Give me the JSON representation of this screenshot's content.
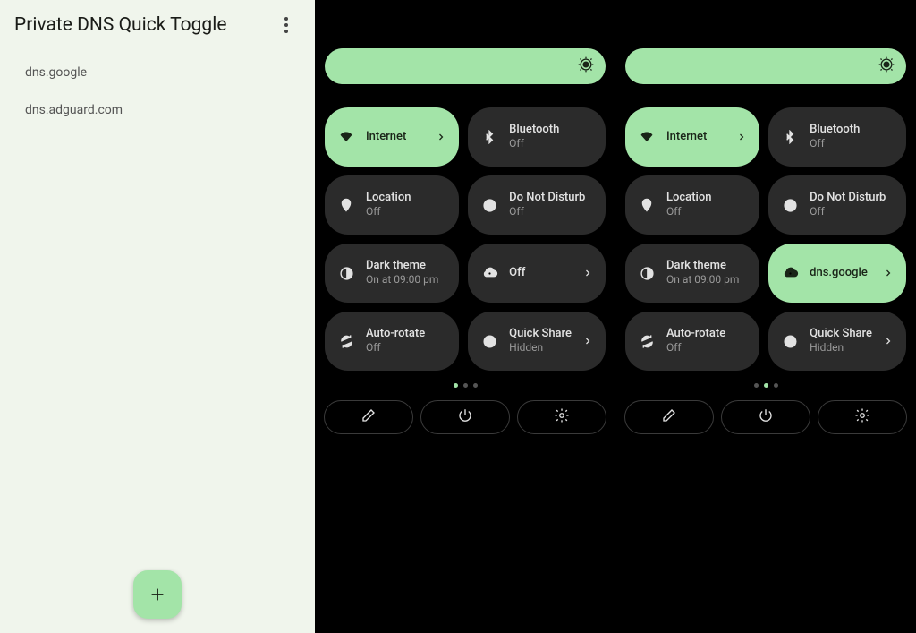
{
  "app": {
    "title": "Private DNS Quick Toggle",
    "dns_entries": [
      "dns.google",
      "dns.adguard.com"
    ]
  },
  "colors": {
    "accent": "#a3e4a8",
    "tile_bg": "#2b2b2b"
  },
  "panels": [
    {
      "tiles": [
        {
          "icon": "wifi",
          "title": "Internet",
          "sub": "",
          "active": true,
          "chevron": true
        },
        {
          "icon": "bt",
          "title": "Bluetooth",
          "sub": "Off",
          "active": false,
          "chevron": false
        },
        {
          "icon": "location",
          "title": "Location",
          "sub": "Off",
          "active": false,
          "chevron": false
        },
        {
          "icon": "dnd",
          "title": "Do Not Disturb",
          "sub": "Off",
          "active": false,
          "chevron": false
        },
        {
          "icon": "dark",
          "title": "Dark theme",
          "sub": "On at 09:00 pm",
          "active": false,
          "chevron": false
        },
        {
          "icon": "cloud",
          "title": "Off",
          "sub": "",
          "active": false,
          "chevron": true
        },
        {
          "icon": "rotate",
          "title": "Auto-rotate",
          "sub": "Off",
          "active": false,
          "chevron": false
        },
        {
          "icon": "share",
          "title": "Quick Share",
          "sub": "Hidden",
          "active": false,
          "chevron": true
        }
      ],
      "active_dot": 0
    },
    {
      "tiles": [
        {
          "icon": "wifi",
          "title": "Internet",
          "sub": "",
          "active": true,
          "chevron": true
        },
        {
          "icon": "bt",
          "title": "Bluetooth",
          "sub": "Off",
          "active": false,
          "chevron": false
        },
        {
          "icon": "location",
          "title": "Location",
          "sub": "Off",
          "active": false,
          "chevron": false
        },
        {
          "icon": "dnd",
          "title": "Do Not Disturb",
          "sub": "Off",
          "active": false,
          "chevron": false
        },
        {
          "icon": "dark",
          "title": "Dark theme",
          "sub": "On at 09:00 pm",
          "active": false,
          "chevron": false
        },
        {
          "icon": "cloud",
          "title": "dns.google",
          "sub": "",
          "active": true,
          "chevron": true
        },
        {
          "icon": "rotate",
          "title": "Auto-rotate",
          "sub": "Off",
          "active": false,
          "chevron": false
        },
        {
          "icon": "share",
          "title": "Quick Share",
          "sub": "Hidden",
          "active": false,
          "chevron": true
        }
      ],
      "active_dot": 1
    }
  ]
}
